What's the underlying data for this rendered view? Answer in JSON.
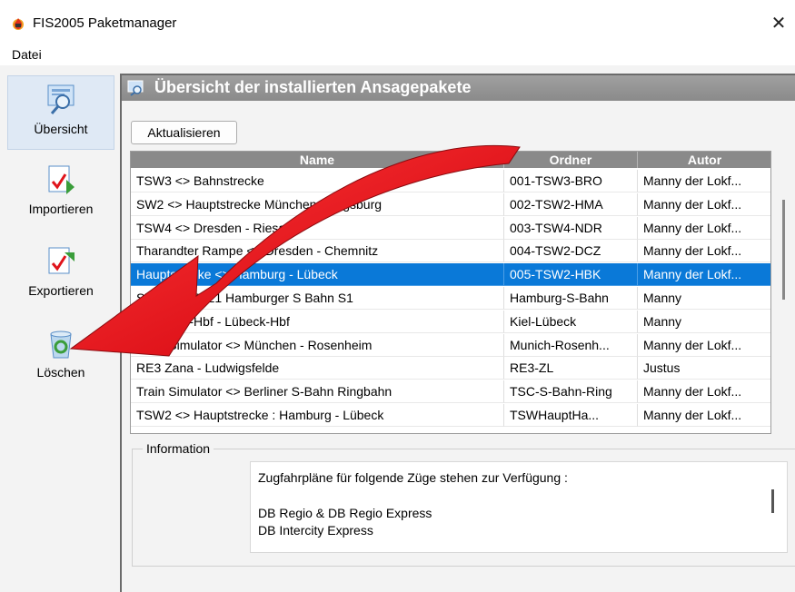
{
  "window": {
    "title": "FIS2005 Paketmanager",
    "close_glyph": "✕"
  },
  "menu": {
    "items": [
      "Datei"
    ]
  },
  "sidebar": {
    "items": [
      {
        "label": "Übersicht",
        "icon": "magnifier-icon"
      },
      {
        "label": "Importieren",
        "icon": "import-icon"
      },
      {
        "label": "Exportieren",
        "icon": "export-icon"
      },
      {
        "label": "Löschen",
        "icon": "recycle-bin-icon"
      }
    ]
  },
  "panel": {
    "title": "Übersicht der installierten Ansagepakete",
    "refresh_label": "Aktualisieren"
  },
  "table": {
    "columns": [
      "Name",
      "Ordner",
      "Autor"
    ],
    "selected_index": 4,
    "rows": [
      {
        "name": "TSW3 <> Bahnstrecke",
        "ordner": "001-TSW3-BRO",
        "autor": "Manny der Lokf..."
      },
      {
        "name": "SW2 <> Hauptstrecke München - Augsburg",
        "ordner": "002-TSW2-HMA",
        "autor": "Manny der Lokf..."
      },
      {
        "name": "TSW4 <> Dresden - Riesa",
        "ordner": "003-TSW4-NDR",
        "autor": "Manny der Lokf..."
      },
      {
        "name": "Tharandter Rampe <> Dresden - Chemnitz",
        "ordner": "004-TSW2-DCZ",
        "autor": "Manny der Lokf..."
      },
      {
        "name": "Hauptstrecke <> Hamburg - Lübeck",
        "ordner": "005-TSW2-HBK",
        "autor": "Manny der Lokf..."
      },
      {
        "name": "Simulator 2021 Hamburger S Bahn S1",
        "ordner": "Hamburg-S-Bahn",
        "autor": "Manny"
      },
      {
        "name": "2021 Kiel-Hbf - Lübeck-Hbf",
        "ordner": "Kiel-Lübeck",
        "autor": "Manny"
      },
      {
        "name": "Train Simulator <> München - Rosenheim",
        "ordner": "Munich-Rosenh...",
        "autor": "Manny der Lokf..."
      },
      {
        "name": "RE3 Zana - Ludwigsfelde",
        "ordner": "RE3-ZL",
        "autor": "Justus"
      },
      {
        "name": "Train Simulator <> Berliner S-Bahn Ringbahn",
        "ordner": "TSC-S-Bahn-Ring",
        "autor": "Manny der Lokf..."
      },
      {
        "name": "TSW2 <> Hauptstrecke : Hamburg - Lübeck",
        "ordner": "TSWHauptHa...",
        "autor": "Manny der Lokf..."
      }
    ]
  },
  "info": {
    "group_label": "Information",
    "lines": [
      "Zugfahrpläne für folgende Züge stehen zur Verfügung :",
      "",
      "DB Regio & DB Regio Express",
      "DB Intercity Express"
    ]
  },
  "colors": {
    "selection": "#0a79d8",
    "header": "#8a8a8a",
    "arrow": "#e0141b"
  }
}
